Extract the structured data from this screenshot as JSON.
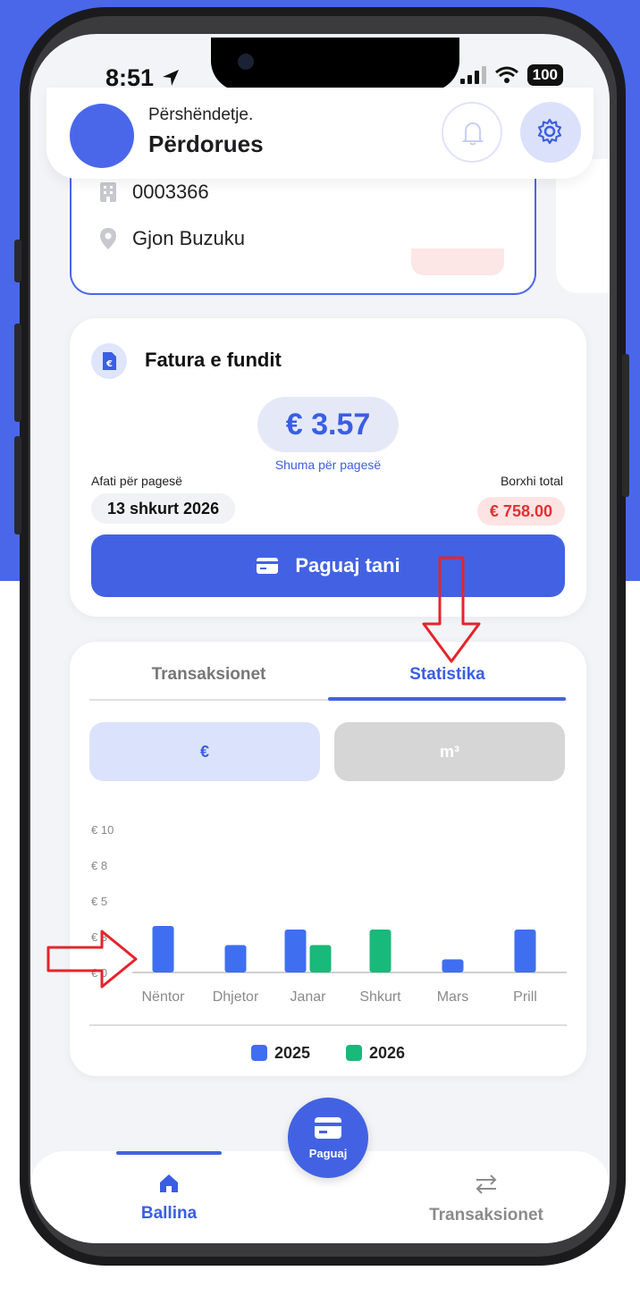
{
  "status_bar": {
    "time": "8:51",
    "battery": "100"
  },
  "header": {
    "greeting": "Përshëndetje.",
    "user_name": "Përdorues"
  },
  "account": {
    "code": "0003366",
    "address": "Gjon Buzuku"
  },
  "invoice": {
    "title": "Fatura e fundit",
    "amount": "€ 3.57",
    "amount_label": "Shuma për pagesë",
    "due_label": "Afati për pagesë",
    "due_date": "13 shkurt 2026",
    "debt_label": "Borxhi total",
    "debt_value": "€ 758.00",
    "pay_button": "Paguaj tani"
  },
  "stats": {
    "tabs": [
      {
        "label": "Transaksionet",
        "active": false
      },
      {
        "label": "Statistika",
        "active": true
      }
    ],
    "unit_buttons": [
      {
        "label": "€",
        "active": true
      },
      {
        "label": "m³",
        "active": false
      }
    ]
  },
  "chart_data": {
    "type": "bar",
    "categories": [
      "Nëntor",
      "Dhjetor",
      "Janar",
      "Shkurt",
      "Mars",
      "Prill"
    ],
    "y_ticks": [
      "€ 10",
      "€ 8",
      "€ 5",
      "€ 3",
      "€ 0"
    ],
    "y_tick_values": [
      10,
      8,
      5,
      3,
      0
    ],
    "ylim": [
      0,
      10
    ],
    "series": [
      {
        "name": "2025",
        "color": "#3f6ff0",
        "values": [
          3.6,
          2.3,
          3.4,
          null,
          1.1,
          3.4
        ]
      },
      {
        "name": "2026",
        "color": "#19b87b",
        "values": [
          null,
          null,
          2.3,
          3.4,
          null,
          null
        ]
      }
    ],
    "legend_position": "bottom",
    "grid": false
  },
  "nav": {
    "fab_label": "Paguaj",
    "items": [
      {
        "label": "Ballina",
        "icon": "home-icon",
        "active": true
      },
      {
        "label": "Transaksionet",
        "icon": "transfer-arrows-icon",
        "active": false
      }
    ]
  },
  "colors": {
    "accent": "#4262e3",
    "debt": "#e23131",
    "annotation": "#e5242b"
  }
}
